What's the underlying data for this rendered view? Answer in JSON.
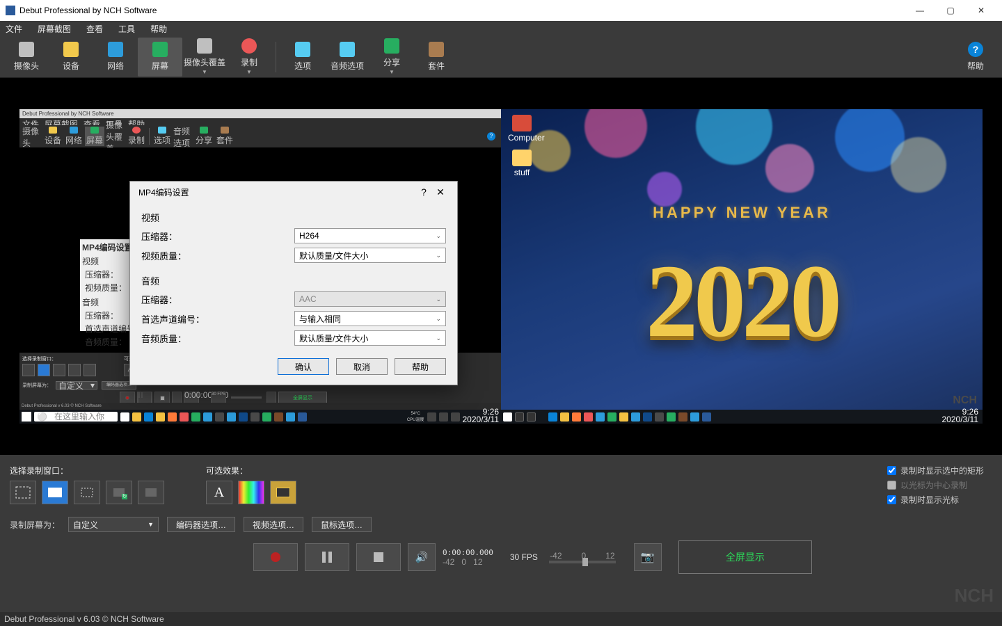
{
  "window": {
    "title": "Debut Professional by NCH Software",
    "min": "—",
    "max": "▢",
    "close": "✕"
  },
  "menubar": [
    "文件",
    "屏幕截图",
    "查看",
    "工具",
    "帮助"
  ],
  "toolbar": [
    {
      "label": "摄像头",
      "color": "#bfbfbf"
    },
    {
      "label": "设备",
      "color": "#f2c94c"
    },
    {
      "label": "网络",
      "color": "#2d9cdb"
    },
    {
      "label": "屏幕",
      "color": "#27ae60",
      "active": true
    },
    {
      "label": "摄像头覆盖",
      "color": "#bfbfbf",
      "arrow": true
    },
    {
      "label": "录制",
      "color": "#eb5757",
      "arrow": true
    }
  ],
  "toolbar2": [
    {
      "label": "选项",
      "color": "#56ccf2"
    },
    {
      "label": "音频选项",
      "color": "#56ccf2"
    },
    {
      "label": "分享",
      "color": "#27ae60",
      "arrow": true
    },
    {
      "label": "套件",
      "color": "#a97c50"
    }
  ],
  "toolbar_help": {
    "label": "帮助"
  },
  "preview": {
    "mini_title": "Debut Professional by NCH Software",
    "mini_menu": [
      "文件",
      "屏幕截图",
      "查看",
      "工具",
      "帮助"
    ],
    "search_placeholder": "在这里输入你要搜索的内容",
    "clock": "9:26",
    "date": "2020/3/11",
    "hny": "HAPPY  NEW  YEAR",
    "year": "2020",
    "desk1": "Computer",
    "desk2": "stuff",
    "status_left": "Debut Professional v 6.03 © NCH Software"
  },
  "mini_dialog": {
    "title": "MP4编码设置",
    "s1": "视频",
    "l1": "压缩器：",
    "l2": "视频质量：",
    "s2": "音频",
    "l3": "压缩器：",
    "l4": "首选声道编号：",
    "l5": "音频质量："
  },
  "options": {
    "select_window_label": "选择录制窗口：",
    "effects_label": "可选效果：",
    "chk1": "录制时显示选中的矩形",
    "chk2": "以光标为中心录制",
    "chk3": "录制时显示光标",
    "screen_for_label": "录制屏幕为：",
    "screen_for_value": "自定义",
    "encoder_btn": "编码器选项…",
    "video_btn": "视频选项…",
    "mouse_btn": "鼠标选项…",
    "timecode": "0:00:00.000",
    "fps": "30 FPS",
    "zoom_lo": "-42",
    "zoom_mid": "0",
    "zoom_hi": "12",
    "fullscreen": "全屏显示"
  },
  "status": "Debut Professional v 6.03 © NCH Software",
  "dialog": {
    "title": "MP4编码设置",
    "help": "?",
    "close": "✕",
    "video_section": "视频",
    "audio_section": "音频",
    "compressor_label": "压缩器：",
    "vquality_label": "视频质量：",
    "channels_label": "首选声道编号：",
    "aquality_label": "音频质量：",
    "h264": "H264",
    "default_quality": "默认质量/文件大小",
    "aac": "AAC",
    "channels_value": "与输入相同",
    "ok": "确认",
    "cancel": "取消",
    "help_btn": "帮助"
  }
}
